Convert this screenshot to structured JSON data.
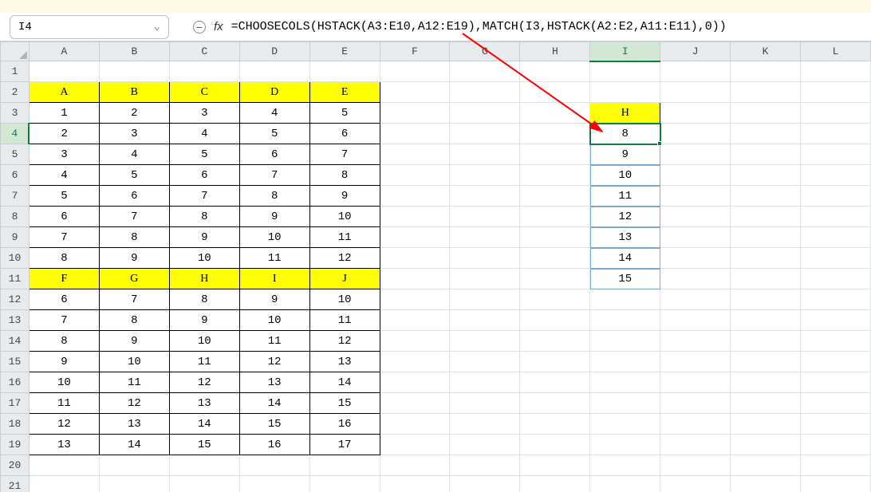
{
  "nameBox": "I4",
  "formula": "=CHOOSECOLS(HSTACK(A3:E10,A12:E19),MATCH(I3,HSTACK(A2:E2,A11:E11),0))",
  "colHeaders": [
    "A",
    "B",
    "C",
    "D",
    "E",
    "F",
    "G",
    "H",
    "I",
    "J",
    "K",
    "L"
  ],
  "rowHeaders": [
    "1",
    "2",
    "3",
    "4",
    "5",
    "6",
    "7",
    "8",
    "9",
    "10",
    "11",
    "12",
    "13",
    "14",
    "15",
    "16",
    "17",
    "18",
    "19",
    "20",
    "21"
  ],
  "activeCol": "I",
  "activeRow": "4",
  "leftHeaders1": [
    "A",
    "B",
    "C",
    "D",
    "E"
  ],
  "leftData1": [
    [
      "1",
      "2",
      "3",
      "4",
      "5"
    ],
    [
      "2",
      "3",
      "4",
      "5",
      "6"
    ],
    [
      "3",
      "4",
      "5",
      "6",
      "7"
    ],
    [
      "4",
      "5",
      "6",
      "7",
      "8"
    ],
    [
      "5",
      "6",
      "7",
      "8",
      "9"
    ],
    [
      "6",
      "7",
      "8",
      "9",
      "10"
    ],
    [
      "7",
      "8",
      "9",
      "10",
      "11"
    ],
    [
      "8",
      "9",
      "10",
      "11",
      "12"
    ]
  ],
  "leftHeaders2": [
    "F",
    "G",
    "H",
    "I",
    "J"
  ],
  "leftData2": [
    [
      "6",
      "7",
      "8",
      "9",
      "10"
    ],
    [
      "7",
      "8",
      "9",
      "10",
      "11"
    ],
    [
      "8",
      "9",
      "10",
      "11",
      "12"
    ],
    [
      "9",
      "10",
      "11",
      "12",
      "13"
    ],
    [
      "10",
      "11",
      "12",
      "13",
      "14"
    ],
    [
      "11",
      "12",
      "13",
      "14",
      "15"
    ],
    [
      "12",
      "13",
      "14",
      "15",
      "16"
    ],
    [
      "13",
      "14",
      "15",
      "16",
      "17"
    ]
  ],
  "rightHeader": "H",
  "rightData": [
    "8",
    "9",
    "10",
    "11",
    "12",
    "13",
    "14",
    "15"
  ]
}
